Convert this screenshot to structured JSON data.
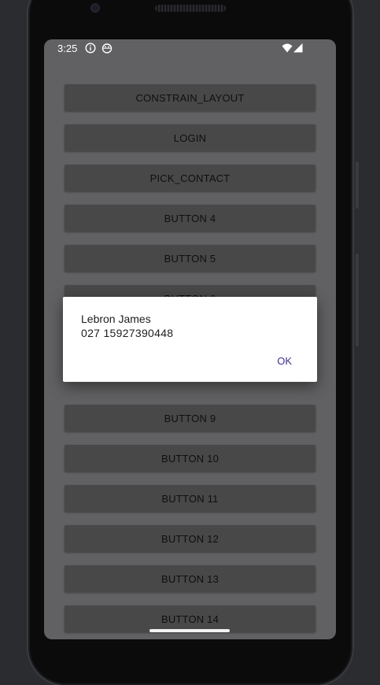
{
  "status_bar": {
    "time": "3:25",
    "icons": [
      "info-icon",
      "android-icon",
      "wifi-icon",
      "signal-icon"
    ]
  },
  "buttons": [
    "CONSTRAIN_LAYOUT",
    "LOGIN",
    "PICK_CONTACT",
    "BUTTON 4",
    "BUTTON 5",
    "BUTTON 6",
    "BUTTON 9",
    "BUTTON 10",
    "BUTTON 11",
    "BUTTON 12",
    "BUTTON 13",
    "BUTTON 14"
  ],
  "dialog": {
    "name": "Lebron James",
    "phone": "027 15927390448",
    "ok_label": "OK"
  },
  "colors": {
    "screen_background": "#616062",
    "button_background": "#484849",
    "dialog_background": "#ffffff",
    "dialog_accent": "#3d2f8f"
  }
}
